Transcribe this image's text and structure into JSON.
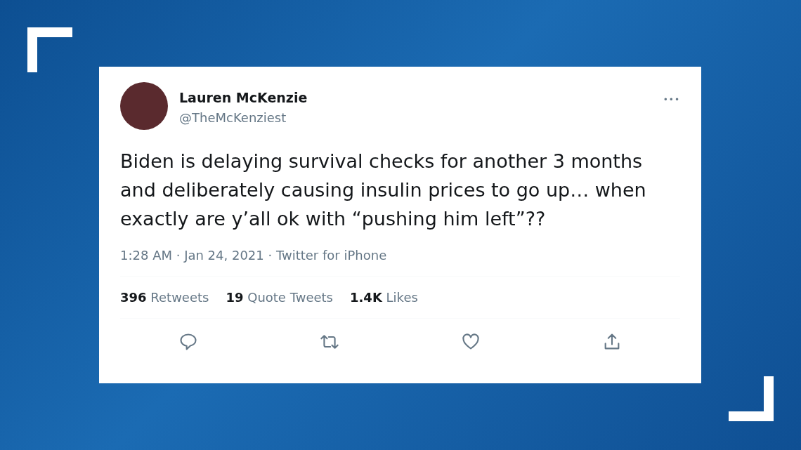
{
  "tweet": {
    "author": {
      "name": "Lauren McKenzie",
      "handle": "@TheMcKenziest"
    },
    "more": "•••",
    "text": "Biden is delaying survival checks for another 3 months and deliberately causing insulin prices to go up… when exactly are y’all ok with “pushing him left”??",
    "meta": "1:28 AM · Jan 24, 2021 · Twitter for iPhone",
    "stats": [
      {
        "count": "396",
        "label": "Retweets"
      },
      {
        "count": "19",
        "label": "Quote Tweets"
      },
      {
        "count": "1.4K",
        "label": "Likes"
      }
    ],
    "actions": [
      {
        "kind": "reply"
      },
      {
        "kind": "retweet"
      },
      {
        "kind": "like"
      },
      {
        "kind": "share"
      }
    ]
  }
}
